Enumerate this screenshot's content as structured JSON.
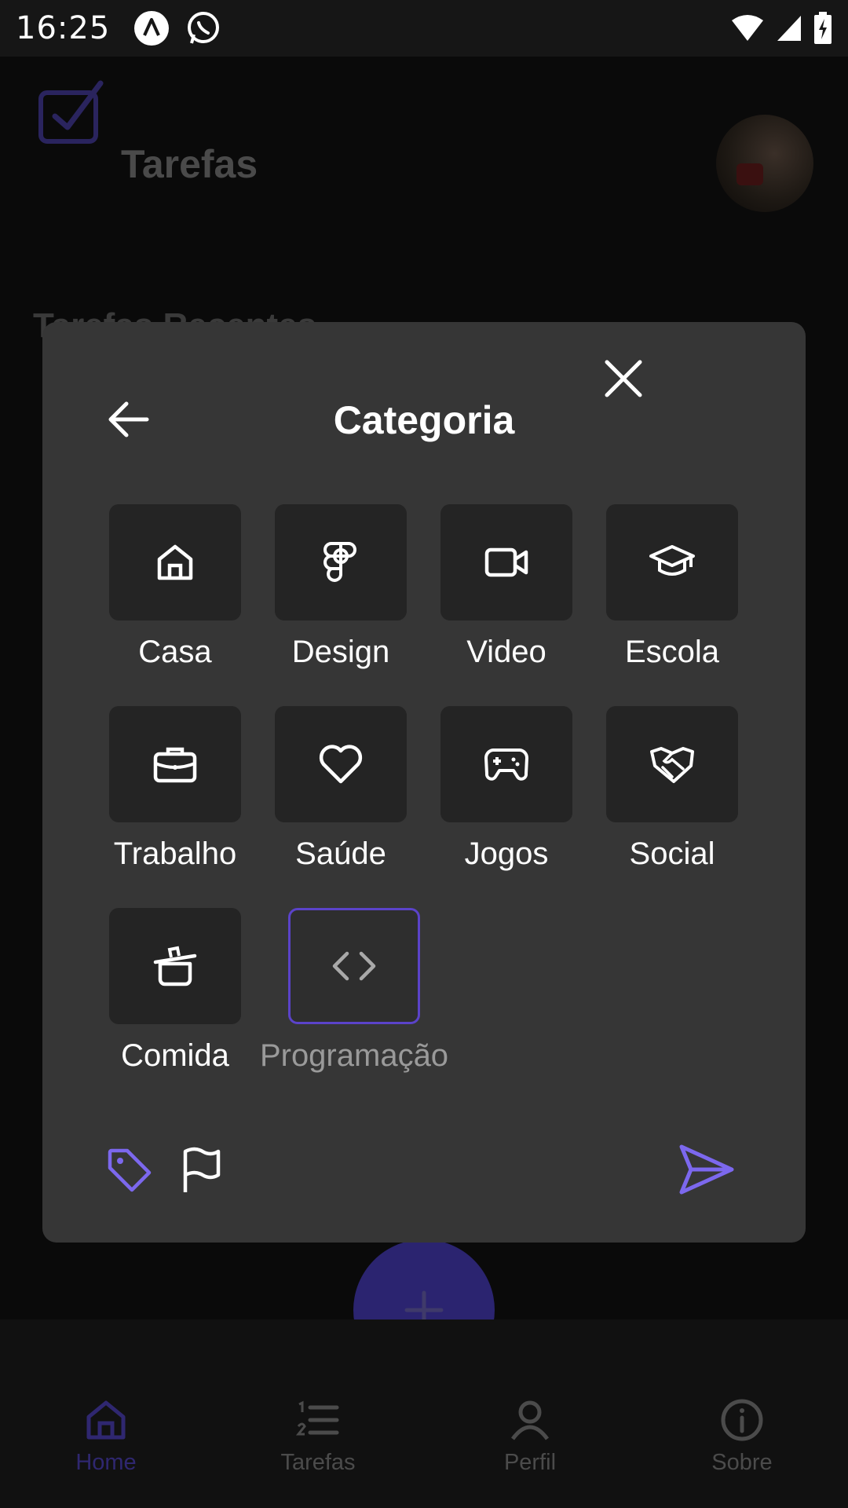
{
  "status_bar": {
    "time": "16:25",
    "left_icons": [
      "app-notification-icon",
      "whatsapp-icon"
    ],
    "right_icons": [
      "wifi-icon",
      "signal-icon",
      "battery-charging-icon"
    ]
  },
  "app": {
    "title": "Tarefas",
    "section_title": "Tarefas Recentes",
    "accent_color": "#7c68ee"
  },
  "modal": {
    "title": "Categoria",
    "categories": [
      {
        "label": "Casa",
        "icon": "home-icon"
      },
      {
        "label": "Design",
        "icon": "figma-icon"
      },
      {
        "label": "Video",
        "icon": "video-camera-icon"
      },
      {
        "label": "Escola",
        "icon": "graduation-cap-icon"
      },
      {
        "label": "Trabalho",
        "icon": "briefcase-icon"
      },
      {
        "label": "Saúde",
        "icon": "heart-icon"
      },
      {
        "label": "Jogos",
        "icon": "gamepad-icon"
      },
      {
        "label": "Social",
        "icon": "handshake-icon"
      },
      {
        "label": "Comida",
        "icon": "cooking-pot-icon"
      },
      {
        "label": "Programação",
        "icon": "code-icon"
      }
    ],
    "selected": "Programação"
  },
  "bottom_nav": {
    "items": [
      {
        "label": "Home",
        "icon": "home-icon",
        "active": true
      },
      {
        "label": "Tarefas",
        "icon": "list-numbers-icon",
        "active": false
      },
      {
        "label": "Perfil",
        "icon": "user-icon",
        "active": false
      },
      {
        "label": "Sobre",
        "icon": "info-icon",
        "active": false
      }
    ]
  }
}
